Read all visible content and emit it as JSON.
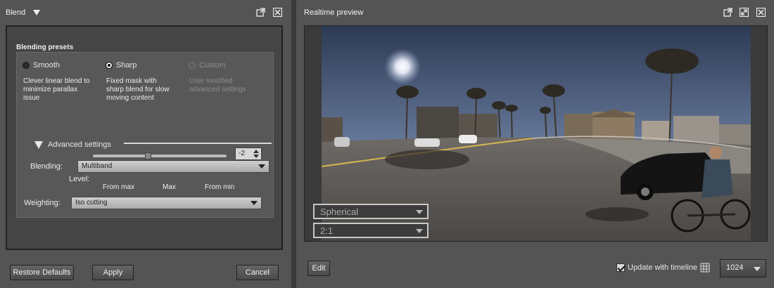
{
  "blend": {
    "title": "Blend",
    "presets_title": "Blending presets",
    "presets": [
      {
        "label": "Smooth",
        "desc_lines": [
          "Clever linear blend to",
          "minimize parallax",
          "issue"
        ],
        "selected": false,
        "enabled": true
      },
      {
        "label": "Sharp",
        "desc_lines": [
          "Fixed mask with",
          "sharp blend for slow",
          "moving content"
        ],
        "selected": true,
        "enabled": true
      },
      {
        "label": "Custom",
        "desc_lines": [
          "User modified",
          "advanced settings"
        ],
        "selected": false,
        "enabled": false
      }
    ],
    "advanced_label": "Advanced settings",
    "blending_label": "Blending:",
    "blending_value": "Multiband",
    "slider_labels": {
      "from_max": "From max",
      "max": "Max",
      "from_min": "From min"
    },
    "level_label": "Level:",
    "level_value": "-2",
    "weighting_label": "Weighting:",
    "weighting_value": "Iso cutting",
    "buttons": {
      "restore": "Restore Defaults",
      "apply": "Apply",
      "cancel": "Cancel"
    }
  },
  "preview": {
    "title": "Realtime preview",
    "projection": "Spherical",
    "ratio": "2:1",
    "edit_label": "Edit",
    "update_label": "Update with timeline",
    "update_checked": true,
    "resolution": "1024"
  },
  "icons": {
    "blend_menu": "triangle-down-icon",
    "popout": "popout-icon",
    "close": "close-icon",
    "fullscreen": "fullscreen-icon",
    "grid": "grid-icon"
  }
}
